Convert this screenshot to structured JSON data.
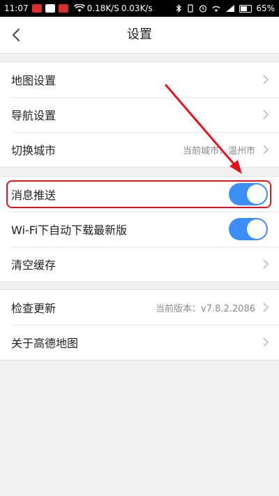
{
  "status_bar": {
    "time": "11:07",
    "net_speed_1": "0.18K/S",
    "net_speed_2": "0.03K/s",
    "battery": "65%"
  },
  "header": {
    "title": "设置"
  },
  "groups": [
    {
      "items": [
        {
          "label": "地图设置",
          "value": ""
        },
        {
          "label": "导航设置",
          "value": ""
        },
        {
          "label": "切换城市",
          "value": "当前城市：温州市"
        }
      ]
    },
    {
      "items": [
        {
          "label": "消息推送",
          "toggle": true
        },
        {
          "label": "Wi-Fi下自动下载最新版",
          "toggle": true
        },
        {
          "label": "清空缓存",
          "value": ""
        }
      ]
    },
    {
      "items": [
        {
          "label": "检查更新",
          "value": "当前版本：v7.8.2.2086"
        },
        {
          "label": "关于高德地图",
          "value": ""
        }
      ]
    }
  ],
  "colors": {
    "toggle_on": "#3d8ff5",
    "annotation": "#e0141e"
  }
}
